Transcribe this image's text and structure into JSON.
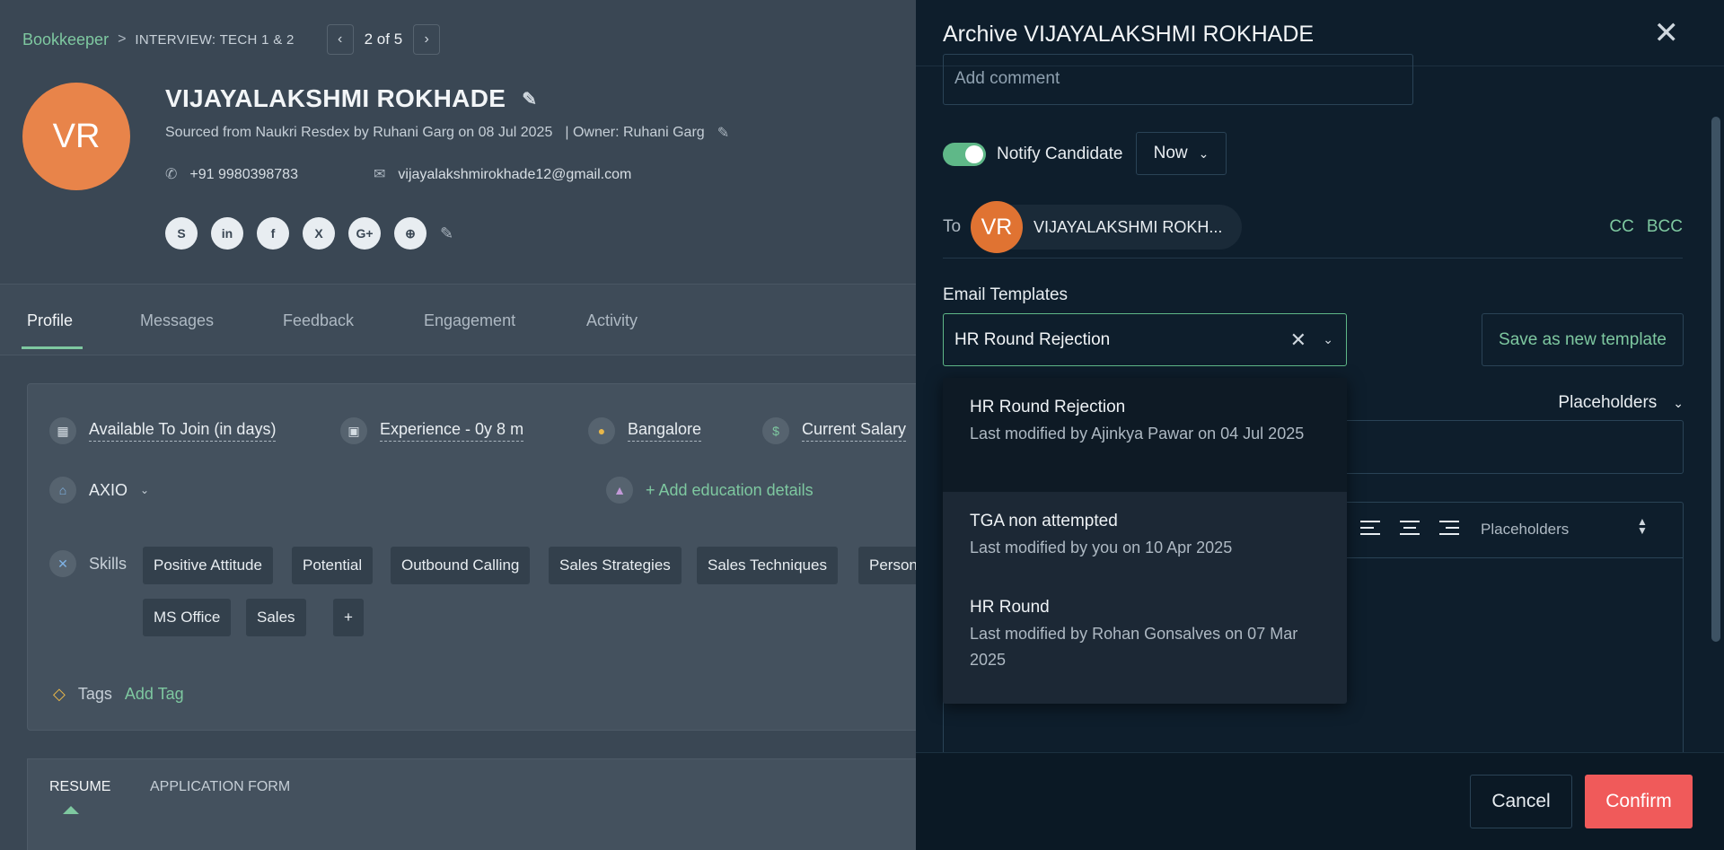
{
  "breadcrumb": {
    "root": "Bookkeeper",
    "separator": ">",
    "current": "INTERVIEW: TECH 1 & 2"
  },
  "pager": {
    "count": "2 of 5"
  },
  "candidate": {
    "initials": "VR",
    "name": "VIJAYALAKSHMI ROKHADE",
    "sourced": "Sourced from Naukri Resdex by Ruhani Garg on 08 Jul 2025",
    "owner": "| Owner: Ruhani Garg",
    "phone": "+91 9980398783",
    "email": "vijayalakshmirokhade12@gmail.com"
  },
  "socials": [
    "S",
    "in",
    "f",
    "X",
    "G+",
    "⊕"
  ],
  "tabs": [
    "Profile",
    "Messages",
    "Feedback",
    "Engagement",
    "Activity"
  ],
  "profile": {
    "available": "Available To Join (in days)",
    "experience": "Experience - 0y 8 m",
    "location": "Bangalore",
    "salary": "Current Salary",
    "company": "AXIO",
    "add_education": "+ Add education details",
    "skills_label": "Skills",
    "skills": [
      "Positive Attitude",
      "Potential",
      "Outbound Calling",
      "Sales Strategies",
      "Sales Techniques",
      "Person",
      "MS Office",
      "Sales"
    ],
    "tags_label": "Tags",
    "add_tag": "Add Tag"
  },
  "resume_tabs": [
    "RESUME",
    "APPLICATION FORM"
  ],
  "panel": {
    "title": "Archive VIJAYALAKSHMI ROKHADE",
    "comment_placeholder": "Add comment",
    "notify_label": "Notify Candidate",
    "notify_when": "Now",
    "to_label": "To",
    "recipient_initials": "VR",
    "recipient_name": "VIJAYALAKSHMI ROKH...",
    "cc": "CC",
    "bcc": "BCC",
    "templates_label": "Email Templates",
    "selected_template": "HR Round Rejection",
    "save_template": "Save as new template",
    "placeholders_label": "Placeholders",
    "editor_placeholders": "Placeholders",
    "cancel": "Cancel",
    "confirm": "Confirm"
  },
  "dropdown": [
    {
      "title": "HR Round Rejection",
      "sub": "Last modified by Ajinkya Pawar on 04 Jul 2025"
    },
    {
      "title": "TGA non attempted",
      "sub": "Last modified by you on 10 Apr 2025"
    },
    {
      "title": "HR Round",
      "sub": "Last modified by Rohan Gonsalves on 07 Mar 2025"
    }
  ],
  "colors": {
    "accent": "#7ec8a0",
    "danger": "#f05a5a",
    "avatar": "#e8844a"
  }
}
